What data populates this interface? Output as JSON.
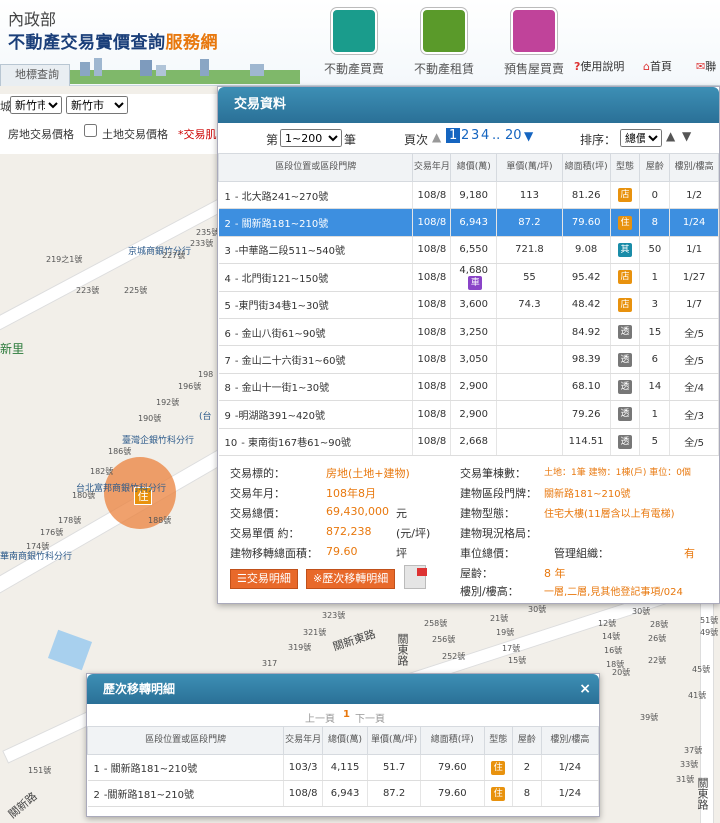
{
  "header": {
    "ministry": "內政部",
    "title_main": "不動產交易實價查詢",
    "title_accent": "服務網",
    "nav": [
      {
        "label": "不動產買賣",
        "color": "#1a9c8c"
      },
      {
        "label": "不動產租賃",
        "color": "#5a9a2a"
      },
      {
        "label": "預售屋買賣",
        "color": "#c0439a"
      }
    ],
    "help": "使用說明",
    "home": "首頁",
    "contact": "聯"
  },
  "locate_tab": "地標查詢",
  "filters": {
    "prefix": "城",
    "city": "新竹市",
    "district": "新竹市",
    "house_price": "房地交易價格",
    "land_price": "土地交易價格",
    "deal_tab": "*交易肌"
  },
  "map_labels": {
    "district": "新里",
    "landmarks": [
      "京城商銀竹分行",
      "臺灣企銀竹科分行",
      "台北富邦商銀竹科分行",
      "華南商銀竹科分行",
      "(台"
    ],
    "numbers": [
      "235號",
      "233號",
      "227號",
      "219之1號",
      "223號",
      "225號",
      "198",
      "196號",
      "192號",
      "190號",
      "186號",
      "182號",
      "180號",
      "178號",
      "176號",
      "174號",
      "188號",
      "323號",
      "321號",
      "319號",
      "317",
      "258號",
      "256號",
      "252號",
      "30號",
      "21號",
      "19號",
      "17號",
      "15號",
      "12號",
      "14號",
      "16號",
      "18號",
      "20號",
      "26號",
      "28號",
      "22號",
      "30號",
      "51號",
      "49號",
      "45號",
      "41號",
      "39號",
      "37號",
      "33號",
      "31號",
      "29號",
      "151號"
    ],
    "roads": [
      "關新東路",
      "關東路",
      "關新路",
      "關東路"
    ]
  },
  "deal_panel": {
    "title": "交易資料",
    "page_prefix": "第",
    "page_range": "1~200",
    "page_suffix": "筆",
    "page_label": "頁次",
    "pages": [
      "1",
      "2",
      "3",
      "4",
      "..",
      "20"
    ],
    "sort_label": "排序：",
    "sort_value": "總價",
    "columns": [
      "區段位置或區段門牌",
      "交易年月",
      "總價(萬)",
      "單價(萬/坪)",
      "總面積(坪)",
      "型態",
      "屋齡",
      "樓別/樓高"
    ],
    "rows": [
      {
        "no": "1",
        "addr": "- 北大路241~270號",
        "ym": "108/8",
        "total": "9,180",
        "unit": "113",
        "area": "81.26",
        "type": "店",
        "tcolor": "#e8920e",
        "age": "0",
        "floor": "1/2"
      },
      {
        "no": "2",
        "addr": "- 關新路181~210號",
        "ym": "108/8",
        "total": "6,943",
        "unit": "87.2",
        "area": "79.60",
        "type": "住",
        "tcolor": "#e8920e",
        "age": "8",
        "floor": "1/24"
      },
      {
        "no": "3",
        "addr": "-中華路二段511~540號",
        "ym": "108/8",
        "total": "6,550",
        "unit": "721.8",
        "area": "9.08",
        "type": "其",
        "tcolor": "#1a8ca8",
        "age": "50",
        "floor": "1/1"
      },
      {
        "no": "4",
        "addr": "- 北門街121~150號",
        "ym": "108/8",
        "total": "4,680",
        "unit": "55",
        "area": "95.42",
        "type": "店",
        "tcolor": "#e8920e",
        "age": "1",
        "floor": "1/27",
        "badge": "車"
      },
      {
        "no": "5",
        "addr": "-東門街34巷1~30號",
        "ym": "108/8",
        "total": "3,600",
        "unit": "74.3",
        "area": "48.42",
        "type": "店",
        "tcolor": "#e8920e",
        "age": "3",
        "floor": "1/7"
      },
      {
        "no": "6",
        "addr": "- 金山八街61~90號",
        "ym": "108/8",
        "total": "3,250",
        "unit": "",
        "area": "84.92",
        "type": "透",
        "tcolor": "#777",
        "age": "15",
        "floor": "全/5"
      },
      {
        "no": "7",
        "addr": "- 金山二十六街31~60號",
        "ym": "108/8",
        "total": "3,050",
        "unit": "",
        "area": "98.39",
        "type": "透",
        "tcolor": "#777",
        "age": "6",
        "floor": "全/5"
      },
      {
        "no": "8",
        "addr": "- 金山十一街1~30號",
        "ym": "108/8",
        "total": "2,900",
        "unit": "",
        "area": "68.10",
        "type": "透",
        "tcolor": "#777",
        "age": "14",
        "floor": "全/4"
      },
      {
        "no": "9",
        "addr": "-明湖路391~420號",
        "ym": "108/8",
        "total": "2,900",
        "unit": "",
        "area": "79.26",
        "type": "透",
        "tcolor": "#777",
        "age": "1",
        "floor": "全/3"
      },
      {
        "no": "10",
        "addr": "- 東南街167巷61~90號",
        "ym": "108/8",
        "total": "2,668",
        "unit": "",
        "area": "114.51",
        "type": "透",
        "tcolor": "#777",
        "age": "5",
        "floor": "全/5"
      }
    ],
    "detail": {
      "target_k": "交易標的：",
      "target_v": "房地(土地+建物)",
      "ym_k": "交易年月：",
      "ym_v": "108年8月",
      "total_k": "交易總價：",
      "total_v": "69,430,000",
      "total_unit": "元",
      "unit_k": "交易單價 約：",
      "unit_v": "872,238",
      "unit_unit": "(元/坪)",
      "area_k": "建物移轉總面積：",
      "area_v": "79.60",
      "area_unit": "坪",
      "count_k": "交易筆棟數：",
      "count_v": "土地：1筆 建物：1棟(戶) 車位：0個",
      "door_k": "建物區段門牌：",
      "door_v": "關新路181~210號",
      "btype_k": "建物型態：",
      "btype_v": "住宅大樓(11層含以上有電梯)",
      "status_k": "建物現況格局：",
      "park_k": "車位總價：",
      "mgmt_k": "管理組織：",
      "mgmt_v": "有",
      "age_k": "屋齡：",
      "age_v": "8 年",
      "floor_k": "樓別/樓高：",
      "floor_v": "一層,二層,見其他登記事項/024"
    },
    "btn_detail": "交易明細",
    "btn_history": "※歷次移轉明細"
  },
  "history": {
    "title": "歷次移轉明細",
    "close": "×",
    "prev": "上一頁",
    "page": "1",
    "next": "下一頁",
    "columns": [
      "區段位置或區段門牌",
      "交易年月",
      "總價(萬)",
      "單價(萬/坪)",
      "總面積(坪)",
      "型態",
      "屋齡",
      "樓別/樓高"
    ],
    "rows": [
      {
        "no": "1",
        "addr": "- 關新路181~210號",
        "ym": "103/3",
        "total": "4,115",
        "unit": "51.7",
        "area": "79.60",
        "type": "住",
        "age": "2",
        "floor": "1/24"
      },
      {
        "no": "2",
        "addr": "-關新路181~210號",
        "ym": "108/8",
        "total": "6,943",
        "unit": "87.2",
        "area": "79.60",
        "type": "住",
        "age": "8",
        "floor": "1/24"
      }
    ]
  }
}
